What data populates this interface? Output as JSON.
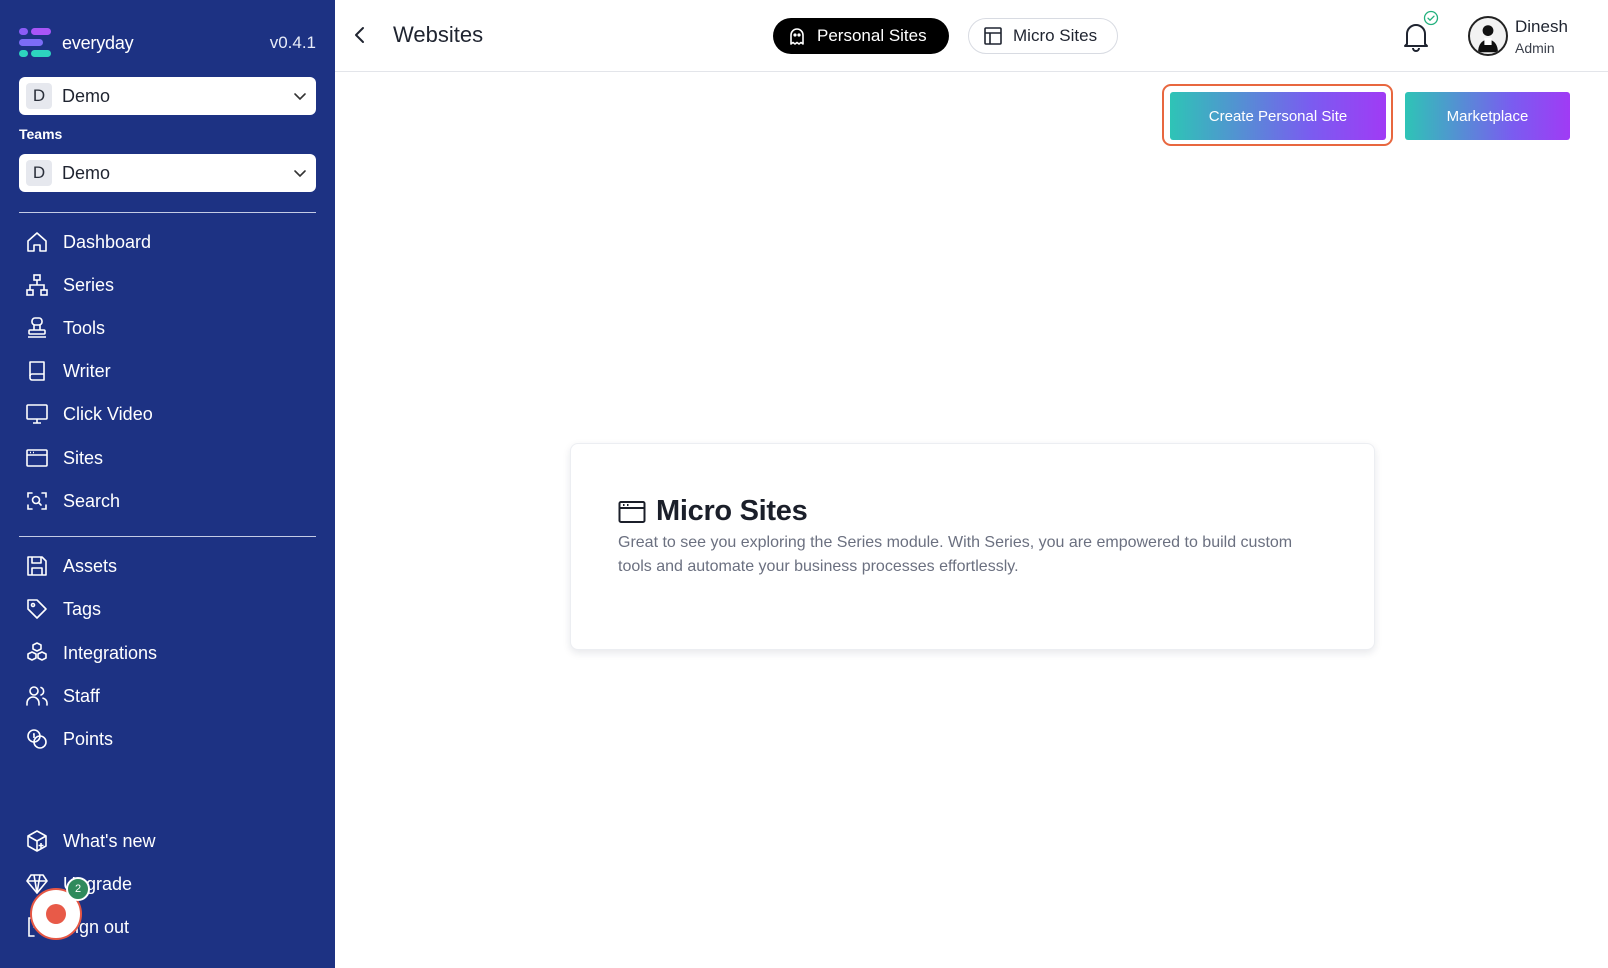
{
  "brand": {
    "name": "everyday",
    "version": "v0.4.1"
  },
  "workspace_select": {
    "letter": "D",
    "value": "Demo"
  },
  "teams": {
    "label": "Teams",
    "letter": "D",
    "value": "Demo"
  },
  "nav_primary": [
    {
      "label": "Dashboard",
      "icon": "home-icon"
    },
    {
      "label": "Series",
      "icon": "sitemap-icon"
    },
    {
      "label": "Tools",
      "icon": "tools-icon"
    },
    {
      "label": "Writer",
      "icon": "book-icon"
    },
    {
      "label": "Click Video",
      "icon": "monitor-icon"
    },
    {
      "label": "Sites",
      "icon": "browser-icon"
    },
    {
      "label": "Search",
      "icon": "scan-search-icon"
    }
  ],
  "nav_secondary": [
    {
      "label": "Assets",
      "icon": "floppy-icon"
    },
    {
      "label": "Tags",
      "icon": "tag-icon"
    },
    {
      "label": "Integrations",
      "icon": "cubes-icon"
    },
    {
      "label": "Staff",
      "icon": "users-icon"
    },
    {
      "label": "Points",
      "icon": "coins-icon"
    }
  ],
  "nav_bottom": [
    {
      "label": "What's new",
      "icon": "box-plus-icon"
    },
    {
      "label": "Upgrade",
      "icon": "diamond-icon"
    },
    {
      "label": "Sign out",
      "icon": "logout-icon"
    }
  ],
  "record_badge": "2",
  "header": {
    "title": "Websites",
    "tabs": [
      {
        "label": "Personal Sites",
        "icon": "ghost-icon",
        "active": true
      },
      {
        "label": "Micro Sites",
        "icon": "layout-icon",
        "active": false
      }
    ],
    "user": {
      "name": "Dinesh",
      "role": "Admin"
    }
  },
  "actions": {
    "create": "Create Personal Site",
    "marketplace": "Marketplace"
  },
  "card": {
    "title": "Micro Sites",
    "description": "Great to see you exploring the Series module. With Series, you are empowered to build custom tools and automate your business processes effortlessly."
  },
  "colors": {
    "sidebar": "#1d3283",
    "accent_start": "#2ec4b6",
    "accent_end": "#a03bf5",
    "focus": "#e8673f"
  }
}
